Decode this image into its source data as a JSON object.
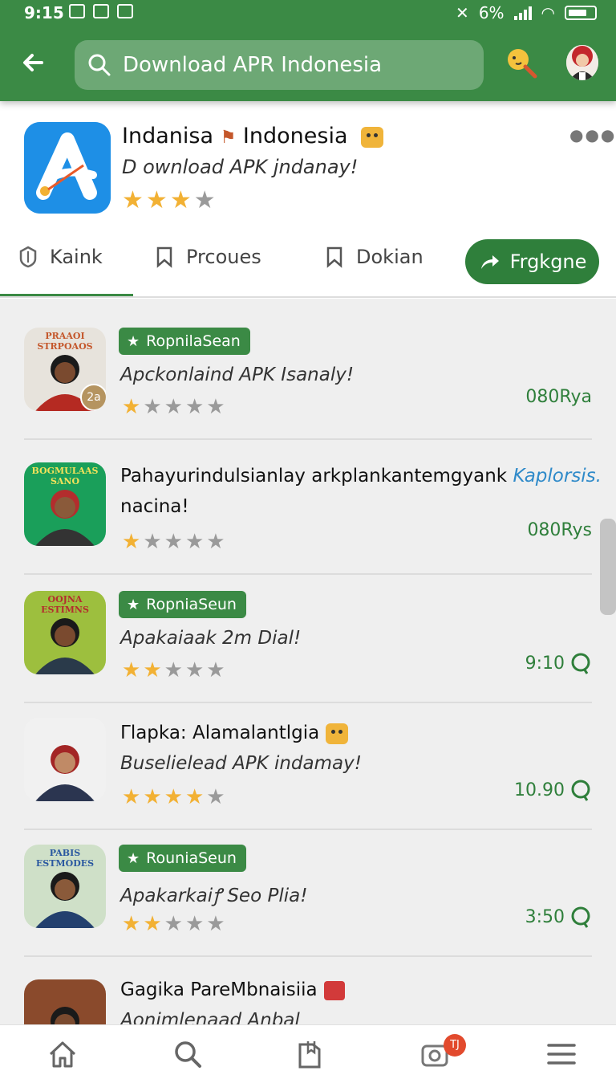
{
  "status_bar": {
    "time": "9:15",
    "battery_text": "6%"
  },
  "search": {
    "query": "Download APR Indonesia"
  },
  "app": {
    "title": "Indanisa",
    "title_suffix": "Indonesia",
    "subtitle": "D ownload APK jndanay!",
    "rating": 3
  },
  "tabs": [
    {
      "label": "Kaink"
    },
    {
      "label": "Prcoues"
    },
    {
      "label": "Dokian"
    }
  ],
  "follow_button": {
    "label": "Frgkgne"
  },
  "items": [
    {
      "banner": "PRAAOI STRPOAOS",
      "tag": "RopnilaSean",
      "title": "",
      "description": "Apckonlaind APK Isanaly!",
      "rating": 1,
      "meta": "080Rya",
      "badge": "2a"
    },
    {
      "banner": "BOGMULAAS SANO",
      "tag": "",
      "title": "Pahayurindulsianlay arkplankantemgyank",
      "title_link": "Kaplorsis.",
      "description": "nacina!",
      "rating": 1,
      "meta": "080Rys",
      "badge": ""
    },
    {
      "banner": "OOJNA ESTIMNS",
      "tag": "RopniaSeun",
      "title": "",
      "description": "Apakaiaak 2m Dial!",
      "rating": 2,
      "meta": "9:10",
      "badge": ""
    },
    {
      "banner": "",
      "tag": "",
      "title": "Γlapka: Alamalantlgia",
      "description": "Buselielead APK indamay!",
      "rating": 4,
      "meta": "10.90",
      "badge": ""
    },
    {
      "banner": "PABIS ESTMODES",
      "tag": "RouniaSeun",
      "title": "",
      "description": "Apakarkaiꝭ Seo Plia!",
      "rating": 2,
      "meta": "3:50",
      "badge": ""
    },
    {
      "banner": "",
      "tag": "",
      "title": "Gagika PareMbnaisiia",
      "description": "Aonimlenaad Anbal",
      "rating": 0,
      "meta": "",
      "badge": ""
    }
  ],
  "bottom_nav": {
    "badge_count": "TJ"
  },
  "colors": {
    "primary": "#3b8a45",
    "star": "#f2b134",
    "link": "#2f8ac9"
  }
}
